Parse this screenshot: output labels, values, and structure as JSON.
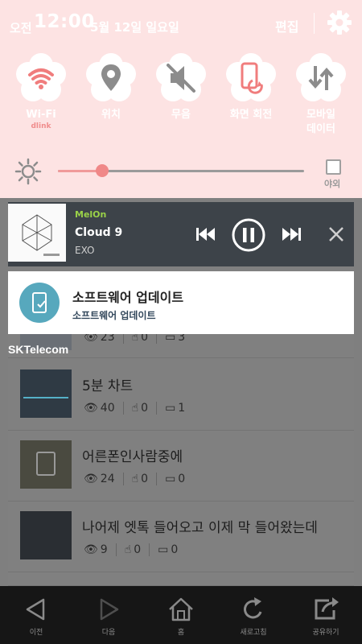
{
  "status": {
    "ampm": "오전",
    "time": "12:00",
    "date": "5월 12일 일요일",
    "edit_label": "편집"
  },
  "quick_settings": [
    {
      "label": "Wi-Fi",
      "sub": "dlink",
      "icon": "wifi-icon",
      "active": true
    },
    {
      "label": "위치",
      "sub": "",
      "icon": "location-icon",
      "active": false
    },
    {
      "label": "무음",
      "sub": "",
      "icon": "mute-icon",
      "active": false
    },
    {
      "label": "화면 회전",
      "sub": "",
      "icon": "rotate-screen-icon",
      "active": false
    },
    {
      "label": "모바일",
      "label2": "데이터",
      "sub": "",
      "icon": "mobile-data-icon",
      "active": false
    }
  ],
  "brightness": {
    "level": 0.18,
    "auto_label": "야외",
    "auto_checked": false
  },
  "music_notification": {
    "app": "MelOn",
    "song": "Cloud 9",
    "artist": "EXO",
    "state": "playing"
  },
  "update_notification": {
    "title": "소프트웨어 업데이트",
    "subtitle": "소프트웨어 업데이트"
  },
  "carrier": "SKTelecom",
  "background_list": [
    {
      "title": "",
      "views": "23",
      "likes": "0",
      "comments": "3"
    },
    {
      "title": "5분 차트",
      "views": "40",
      "likes": "0",
      "comments": "1"
    },
    {
      "title": "어른폰인사람중에",
      "views": "24",
      "likes": "0",
      "comments": "0"
    },
    {
      "title": "나어제 엣톡 들어오고 이제 막 들어왔는데",
      "views": "9",
      "likes": "0",
      "comments": "0"
    }
  ],
  "navbar": [
    {
      "label": "이전",
      "icon": "back-icon"
    },
    {
      "label": "다음",
      "icon": "forward-icon"
    },
    {
      "label": "홈",
      "icon": "home-icon"
    },
    {
      "label": "새로고침",
      "icon": "refresh-icon"
    },
    {
      "label": "공유하기",
      "icon": "share-icon"
    }
  ],
  "colors": {
    "shade_bg": "#fde3e3",
    "accent_pink": "#f08888",
    "melon_green": "#9ad148",
    "update_icon": "#57a8bd",
    "navbar_bg": "#161616"
  }
}
